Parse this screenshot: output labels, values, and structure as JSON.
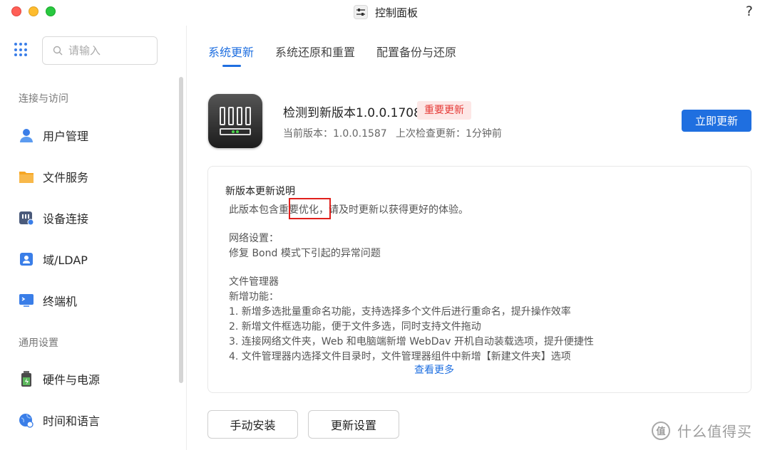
{
  "window": {
    "title": "控制面板",
    "help": "?"
  },
  "sidebar": {
    "search_placeholder": "请输入",
    "section1": "连接与访问",
    "section2": "通用设置",
    "items": [
      {
        "label": "用户管理",
        "icon": "user-icon",
        "color": "#3a7ee8"
      },
      {
        "label": "文件服务",
        "icon": "folder-icon",
        "color": "#f6a623"
      },
      {
        "label": "设备连接",
        "icon": "device-connect-icon",
        "color": "#4a5a7a"
      },
      {
        "label": "域/LDAP",
        "icon": "ldap-icon",
        "color": "#3a7ee8"
      },
      {
        "label": "终端机",
        "icon": "terminal-icon",
        "color": "#3a7ee8"
      },
      {
        "label": "硬件与电源",
        "icon": "battery-icon",
        "color": "#5cb85c"
      },
      {
        "label": "时间和语言",
        "icon": "globe-icon",
        "color": "#3a7ee8"
      }
    ]
  },
  "tabs": [
    "系统更新",
    "系统还原和重置",
    "配置备份与还原"
  ],
  "update": {
    "title": "检测到新版本1.0.0.1708",
    "badge": "重要更新",
    "current_version": "当前版本：1.0.0.1587",
    "last_check": "上次检查更新：1分钟前",
    "update_now": "立即更新"
  },
  "notes": {
    "heading": "新版本更新说明",
    "lines": [
      "此版本包含重要优化，请及时更新以获得更好的体验。",
      "网络设置：",
      "修复 Bond 模式下引起的异常问题",
      "文件管理器",
      "新增功能：",
      "1. 新增多选批量重命名功能，支持选择多个文件后进行重命名，提升操作效率",
      "2. 新增文件框选功能，便于文件多选，同时支持文件拖动",
      "3. 连接网络文件夹，Web 和电脑端新增 WebDav 开机自动装载选项，提升便捷性",
      "4. 文件管理器内选择文件目录时，文件管理器组件中新增【新建文件夹】选项"
    ],
    "more": "查看更多"
  },
  "buttons": {
    "manual_install": "手动安装",
    "update_settings": "更新设置"
  },
  "watermark": {
    "logo": "值",
    "text": "什么值得买"
  },
  "colors": {
    "accent": "#1f6fe0",
    "badge_bg": "#fde7e6",
    "badge_text": "#e53935",
    "highlight": "#e0201c"
  }
}
